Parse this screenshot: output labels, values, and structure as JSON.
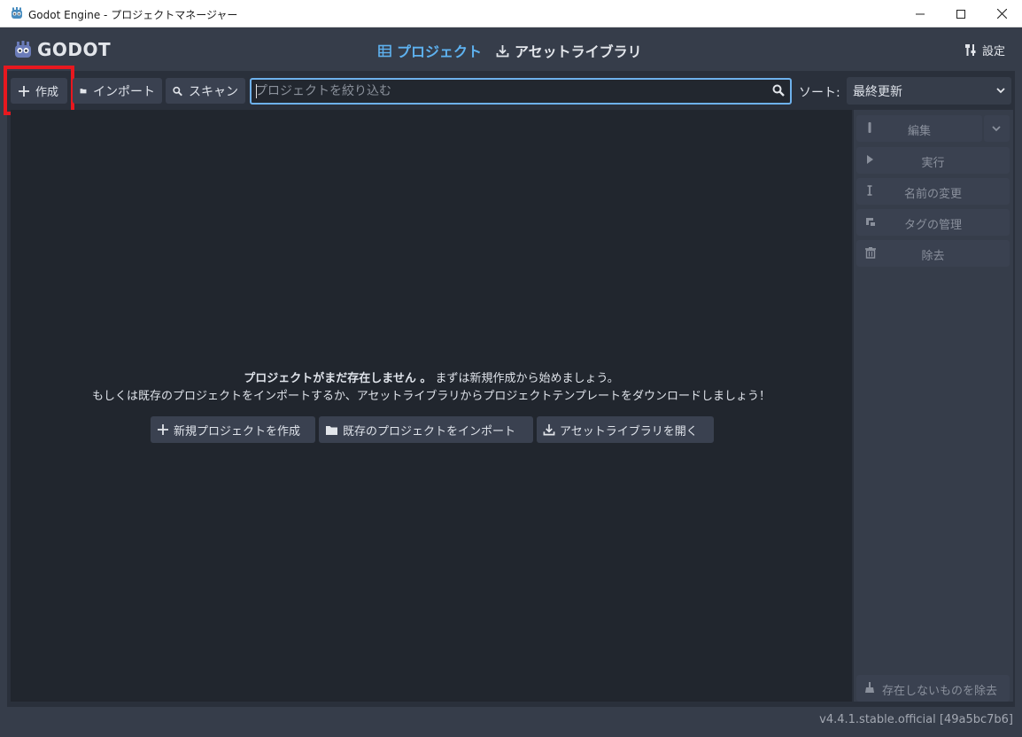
{
  "window": {
    "title": "Godot Engine - プロジェクトマネージャー"
  },
  "header": {
    "logo_text": "GODOT",
    "tabs": [
      {
        "label": "プロジェクト",
        "icon": "project-list-icon",
        "active": true
      },
      {
        "label": "アセットライブラリ",
        "icon": "download-icon",
        "active": false
      }
    ],
    "settings_label": "設定"
  },
  "toolbar": {
    "create_label": "作成",
    "import_label": "インポート",
    "scan_label": "スキャン",
    "search_placeholder": "プロジェクトを絞り込む",
    "sort_label": "ソート:",
    "sort_value": "最終更新"
  },
  "empty_state": {
    "title_bold": "プロジェクトがまだ存在しません 。",
    "title_rest": " まずは新規作成から始めましょう。",
    "subtitle": "もしくは既存のプロジェクトをインポートするか、アセットライブラリからプロジェクトテンプレートをダウンロードしましょう！",
    "buttons": [
      {
        "label": "新規プロジェクトを作成"
      },
      {
        "label": "既存のプロジェクトをインポート"
      },
      {
        "label": "アセットライブラリを開く"
      }
    ]
  },
  "sidebar": {
    "edit": "編集",
    "run": "実行",
    "rename": "名前の変更",
    "manage_tags": "タグの管理",
    "remove": "除去",
    "remove_missing": "存在しないものを除去"
  },
  "version": "v4.4.1.stable.official [49a5bc7b6]",
  "colors": {
    "accent": "#5eb2f0",
    "highlight": "#e8181f"
  }
}
